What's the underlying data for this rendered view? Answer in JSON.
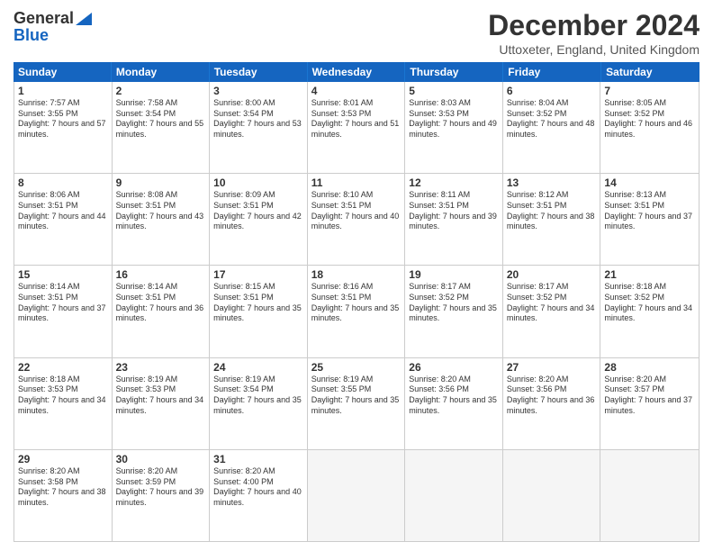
{
  "header": {
    "logo_general": "General",
    "logo_blue": "Blue",
    "month_title": "December 2024",
    "location": "Uttoxeter, England, United Kingdom"
  },
  "days_of_week": [
    "Sunday",
    "Monday",
    "Tuesday",
    "Wednesday",
    "Thursday",
    "Friday",
    "Saturday"
  ],
  "weeks": [
    [
      {
        "day": "1",
        "sunrise": "7:57 AM",
        "sunset": "3:55 PM",
        "daylight": "7 hours and 57 minutes."
      },
      {
        "day": "2",
        "sunrise": "7:58 AM",
        "sunset": "3:54 PM",
        "daylight": "7 hours and 55 minutes."
      },
      {
        "day": "3",
        "sunrise": "8:00 AM",
        "sunset": "3:54 PM",
        "daylight": "7 hours and 53 minutes."
      },
      {
        "day": "4",
        "sunrise": "8:01 AM",
        "sunset": "3:53 PM",
        "daylight": "7 hours and 51 minutes."
      },
      {
        "day": "5",
        "sunrise": "8:03 AM",
        "sunset": "3:53 PM",
        "daylight": "7 hours and 49 minutes."
      },
      {
        "day": "6",
        "sunrise": "8:04 AM",
        "sunset": "3:52 PM",
        "daylight": "7 hours and 48 minutes."
      },
      {
        "day": "7",
        "sunrise": "8:05 AM",
        "sunset": "3:52 PM",
        "daylight": "7 hours and 46 minutes."
      }
    ],
    [
      {
        "day": "8",
        "sunrise": "8:06 AM",
        "sunset": "3:51 PM",
        "daylight": "7 hours and 44 minutes."
      },
      {
        "day": "9",
        "sunrise": "8:08 AM",
        "sunset": "3:51 PM",
        "daylight": "7 hours and 43 minutes."
      },
      {
        "day": "10",
        "sunrise": "8:09 AM",
        "sunset": "3:51 PM",
        "daylight": "7 hours and 42 minutes."
      },
      {
        "day": "11",
        "sunrise": "8:10 AM",
        "sunset": "3:51 PM",
        "daylight": "7 hours and 40 minutes."
      },
      {
        "day": "12",
        "sunrise": "8:11 AM",
        "sunset": "3:51 PM",
        "daylight": "7 hours and 39 minutes."
      },
      {
        "day": "13",
        "sunrise": "8:12 AM",
        "sunset": "3:51 PM",
        "daylight": "7 hours and 38 minutes."
      },
      {
        "day": "14",
        "sunrise": "8:13 AM",
        "sunset": "3:51 PM",
        "daylight": "7 hours and 37 minutes."
      }
    ],
    [
      {
        "day": "15",
        "sunrise": "8:14 AM",
        "sunset": "3:51 PM",
        "daylight": "7 hours and 37 minutes."
      },
      {
        "day": "16",
        "sunrise": "8:14 AM",
        "sunset": "3:51 PM",
        "daylight": "7 hours and 36 minutes."
      },
      {
        "day": "17",
        "sunrise": "8:15 AM",
        "sunset": "3:51 PM",
        "daylight": "7 hours and 35 minutes."
      },
      {
        "day": "18",
        "sunrise": "8:16 AM",
        "sunset": "3:51 PM",
        "daylight": "7 hours and 35 minutes."
      },
      {
        "day": "19",
        "sunrise": "8:17 AM",
        "sunset": "3:52 PM",
        "daylight": "7 hours and 35 minutes."
      },
      {
        "day": "20",
        "sunrise": "8:17 AM",
        "sunset": "3:52 PM",
        "daylight": "7 hours and 34 minutes."
      },
      {
        "day": "21",
        "sunrise": "8:18 AM",
        "sunset": "3:52 PM",
        "daylight": "7 hours and 34 minutes."
      }
    ],
    [
      {
        "day": "22",
        "sunrise": "8:18 AM",
        "sunset": "3:53 PM",
        "daylight": "7 hours and 34 minutes."
      },
      {
        "day": "23",
        "sunrise": "8:19 AM",
        "sunset": "3:53 PM",
        "daylight": "7 hours and 34 minutes."
      },
      {
        "day": "24",
        "sunrise": "8:19 AM",
        "sunset": "3:54 PM",
        "daylight": "7 hours and 35 minutes."
      },
      {
        "day": "25",
        "sunrise": "8:19 AM",
        "sunset": "3:55 PM",
        "daylight": "7 hours and 35 minutes."
      },
      {
        "day": "26",
        "sunrise": "8:20 AM",
        "sunset": "3:56 PM",
        "daylight": "7 hours and 35 minutes."
      },
      {
        "day": "27",
        "sunrise": "8:20 AM",
        "sunset": "3:56 PM",
        "daylight": "7 hours and 36 minutes."
      },
      {
        "day": "28",
        "sunrise": "8:20 AM",
        "sunset": "3:57 PM",
        "daylight": "7 hours and 37 minutes."
      }
    ],
    [
      {
        "day": "29",
        "sunrise": "8:20 AM",
        "sunset": "3:58 PM",
        "daylight": "7 hours and 38 minutes."
      },
      {
        "day": "30",
        "sunrise": "8:20 AM",
        "sunset": "3:59 PM",
        "daylight": "7 hours and 39 minutes."
      },
      {
        "day": "31",
        "sunrise": "8:20 AM",
        "sunset": "4:00 PM",
        "daylight": "7 hours and 40 minutes."
      },
      null,
      null,
      null,
      null
    ]
  ],
  "labels": {
    "sunrise": "Sunrise:",
    "sunset": "Sunset:",
    "daylight": "Daylight:"
  }
}
